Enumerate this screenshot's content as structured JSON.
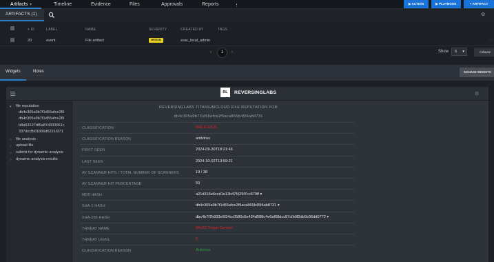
{
  "nav": {
    "tabs": [
      "Artifacts",
      "Timeline",
      "Evidence",
      "Files",
      "Approvals",
      "Reports"
    ],
    "more": "⋮",
    "actions": [
      "▶ ACTION",
      "▶ PLAYBOOK",
      "+ ARTIFACT"
    ]
  },
  "artifacts": {
    "tab_label": "ARTIFACTS (1)",
    "columns": [
      "+ ID",
      "LABEL",
      "NAME",
      "SEVERITY",
      "CREATED BY",
      "TAGS"
    ],
    "row": {
      "id": "20",
      "label": "event",
      "name": "File artifact",
      "severity": "MEDIUM",
      "created_by": "soar_local_admin"
    },
    "pagination": {
      "prev": "‹",
      "page": "1",
      "next": "›"
    },
    "show_label": "Show",
    "show_value": "5",
    "collapse_label": "Collapse"
  },
  "widgets_bar": {
    "tabs": [
      "Widgets",
      "Notes"
    ],
    "manage_label": "MANAGE WIDGETS"
  },
  "widget": {
    "logo": "RL",
    "brand": "REVERSINGLABS",
    "tree": [
      {
        "label": "file reputation",
        "expanded": true
      },
      {
        "label": "db4c305a9b7f1d55afce2f9",
        "child": true
      },
      {
        "label": "db4c305a9b7f1d55afce2f9",
        "child": true
      },
      {
        "label": "b8a63127df6a87d333061c",
        "child": true
      },
      {
        "label": "337dccfb01806d6221f371",
        "child": true
      },
      {
        "label": "file analysis",
        "expanded": false
      },
      {
        "label": "upload file",
        "expanded": false
      },
      {
        "label": "submit for dynamic analysis",
        "expanded": false
      },
      {
        "label": "dynamic analysis results",
        "expanded": false
      }
    ],
    "report_title_1": "REVERSINGLABS TITANIUMCLOUD FILE REPUTATION FOR",
    "report_title_2": "db4c305a9b7f1d55afce2f9aca865b45f4ab8731",
    "rows": [
      {
        "label": "CLASSIFICATION",
        "value": "MALICIOUS",
        "tone": "red"
      },
      {
        "label": "CLASSIFICATION REASON",
        "value": "antivirus",
        "tone": ""
      },
      {
        "label": "FIRST SEEN",
        "value": "2024-09-30T18:21:46",
        "tone": ""
      },
      {
        "label": "LAST SEEN",
        "value": "2024-10-02T13:59:21",
        "tone": ""
      },
      {
        "label": "AV SCANNER HITS / TOTAL NUMBER OF SCANNERS",
        "value": "19 / 38",
        "tone": ""
      },
      {
        "label": "AV SCANNER HIT PERCENTAGE",
        "value": "50",
        "tone": ""
      },
      {
        "label": "MD5 HASH",
        "value": "a21d316e6ccd1e13b47f429f7cc679ff ▾",
        "tone": ""
      },
      {
        "label": "SHA-1 HASH",
        "value": "db4c305a9b7f1d55afce2f9aca865b45f4ab8731 ▾",
        "tone": ""
      },
      {
        "label": "SHA-256 HASH",
        "value": "dbc4b7f7b933e6f34cc0580c6e434d588c4e6af08dcc87cfb0f2db5b36dd0772 ▾",
        "tone": ""
      },
      {
        "label": "THREAT NAME",
        "value": "Win32.Trojan.Generic",
        "tone": "red"
      },
      {
        "label": "THREAT LEVEL",
        "value": "5",
        "tone": "red"
      },
      {
        "label": "CLASSIFICATION REASON",
        "value": "Antivirus",
        "tone": "green"
      }
    ]
  },
  "colors": {
    "accent": "#1a73d9",
    "tab_underline": "#2f7fc7",
    "badge": "#e8d020",
    "danger": "#e0252a",
    "ok": "#2ea043"
  }
}
